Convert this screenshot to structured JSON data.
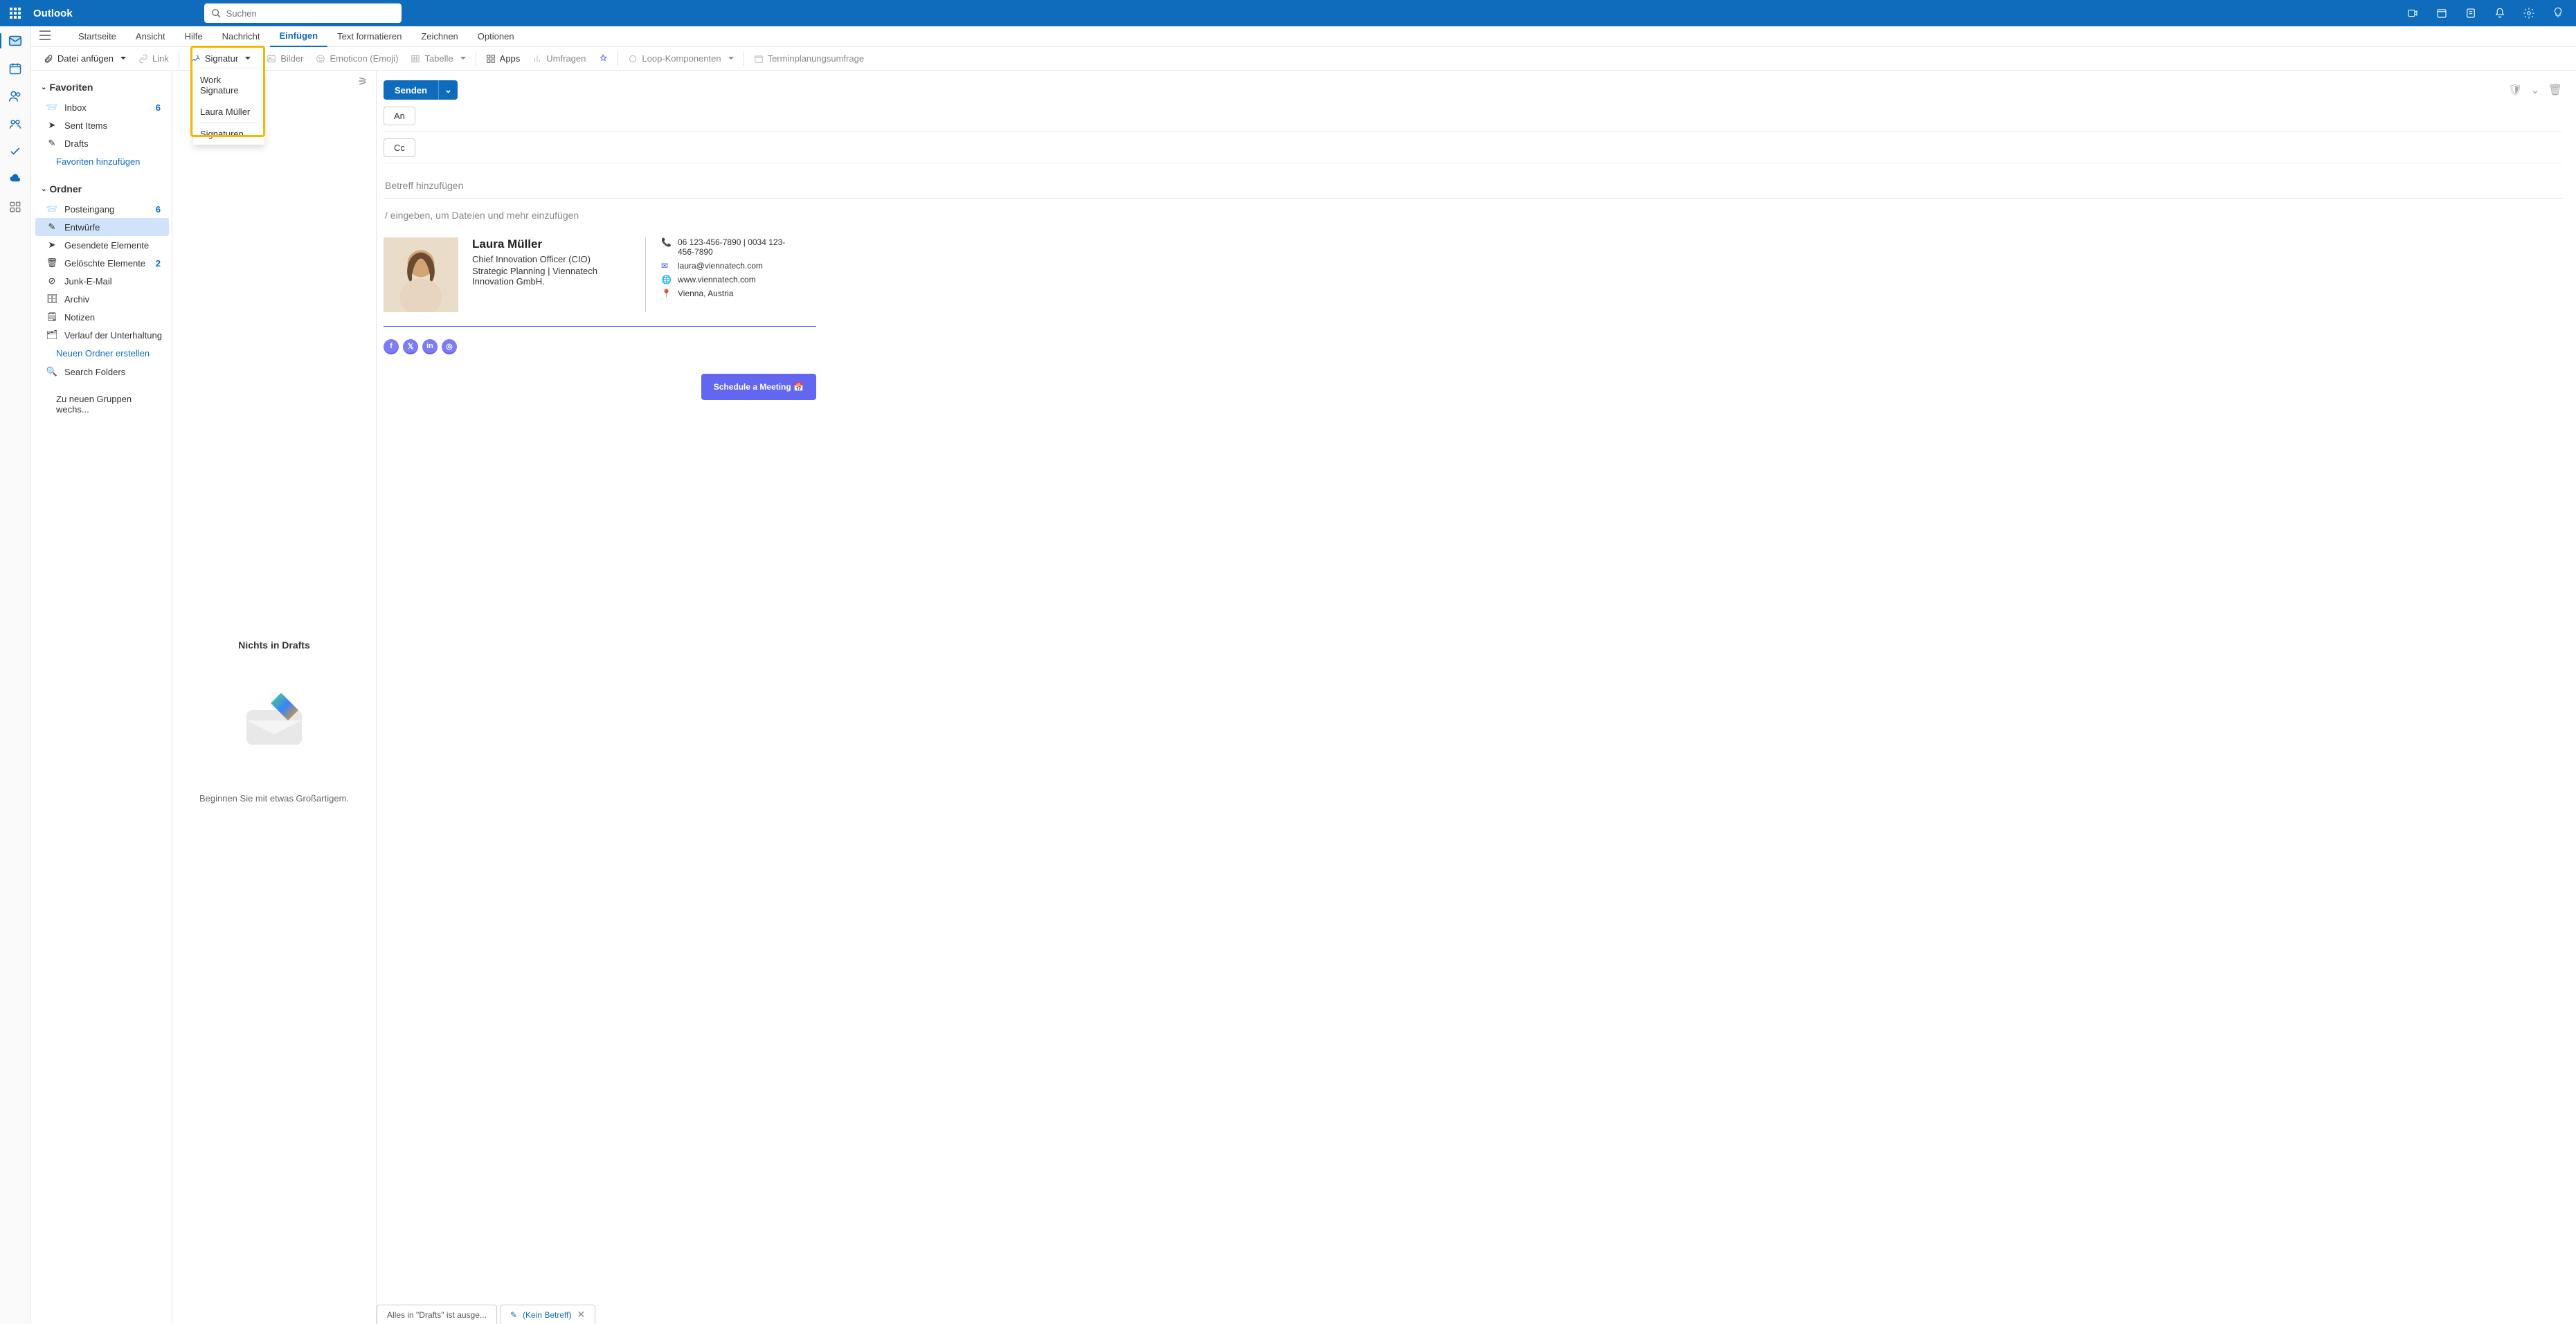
{
  "header": {
    "brand": "Outlook",
    "search_placeholder": "Suchen"
  },
  "menubar": {
    "tabs": [
      "Startseite",
      "Ansicht",
      "Hilfe",
      "Nachricht",
      "Einfügen",
      "Text formatieren",
      "Zeichnen",
      "Optionen"
    ],
    "active": "Einfügen"
  },
  "toolbar": {
    "attach": "Datei anfügen",
    "link": "Link",
    "signature": "Signatur",
    "images": "Bilder",
    "emoji": "Emoticon (Emoji)",
    "table": "Tabelle",
    "apps": "Apps",
    "polls": "Umfragen",
    "loop": "Loop-Komponenten",
    "scheduling": "Terminplanungsumfrage"
  },
  "signature_dropdown": {
    "items": [
      "Work Signature",
      "Laura Müller"
    ],
    "manage": "Signaturen..."
  },
  "sidebar": {
    "favorites_label": "Favoriten",
    "favorites": [
      {
        "icon": "inbox",
        "label": "Inbox",
        "count": "6"
      },
      {
        "icon": "sent",
        "label": "Sent Items",
        "count": ""
      },
      {
        "icon": "drafts",
        "label": "Drafts",
        "count": ""
      }
    ],
    "add_fav": "Favoriten hinzufügen",
    "folders_label": "Ordner",
    "folders": [
      {
        "icon": "inbox",
        "label": "Posteingang",
        "count": "6"
      },
      {
        "icon": "drafts",
        "label": "Entwürfe",
        "count": "",
        "selected": true
      },
      {
        "icon": "sent",
        "label": "Gesendete Elemente",
        "count": ""
      },
      {
        "icon": "trash",
        "label": "Gelöschte Elemente",
        "count": "2"
      },
      {
        "icon": "junk",
        "label": "Junk-E-Mail",
        "count": ""
      },
      {
        "icon": "archive",
        "label": "Archiv",
        "count": ""
      },
      {
        "icon": "notes",
        "label": "Notizen",
        "count": ""
      },
      {
        "icon": "history",
        "label": "Verlauf der Unterhaltung",
        "count": ""
      }
    ],
    "new_folder": "Neuen Ordner erstellen",
    "search_folders": "Search Folders",
    "groups": "Zu neuen Gruppen wechs..."
  },
  "msglist": {
    "empty_title": "Nichts in Drafts",
    "empty_sub": "Beginnen Sie mit etwas Großartigem."
  },
  "compose": {
    "send": "Senden",
    "to": "An",
    "cc": "Cc",
    "subject_placeholder": "Betreff hinzufügen",
    "body_hint": "/ eingeben, um Dateien und mehr einzufügen"
  },
  "signature": {
    "name": "Laura Müller",
    "title": "Chief Innovation Officer (CIO)",
    "dept": "Strategic Planning | Viennatech Innovation GmbH.",
    "phone": "06 123-456-7890 | 0034 123-456-7890",
    "email": "laura@viennatech.com",
    "web": "www.viennatech.com",
    "location": "Vienna, Austria",
    "cta": "Schedule a Meeting 📅"
  },
  "bottom_tabs": {
    "drafts": "Alles in \"Drafts\" ist ausge...",
    "compose": "(Kein Betreff)"
  }
}
